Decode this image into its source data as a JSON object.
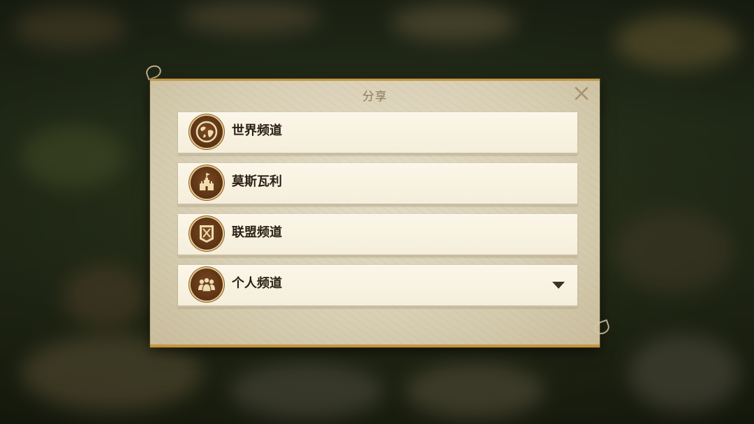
{
  "dialog": {
    "title": "分享",
    "close_icon": "close-icon"
  },
  "channels": [
    {
      "label": "世界频道",
      "icon": "globe-icon"
    },
    {
      "label": "莫斯瓦利",
      "icon": "castle-icon"
    },
    {
      "label": "联盟频道",
      "icon": "alliance-banner-icon"
    },
    {
      "label": "个人频道",
      "icon": "people-icon",
      "dropdown_icon": "triangle-down-icon"
    }
  ],
  "colors": {
    "panel": "#d9d0b6",
    "row_bg": "#f5eedb",
    "icon_bg": "#5a3214",
    "icon_fg": "#f0dcb0",
    "title": "#8f7a58",
    "gold_border": "#c59a4c"
  }
}
